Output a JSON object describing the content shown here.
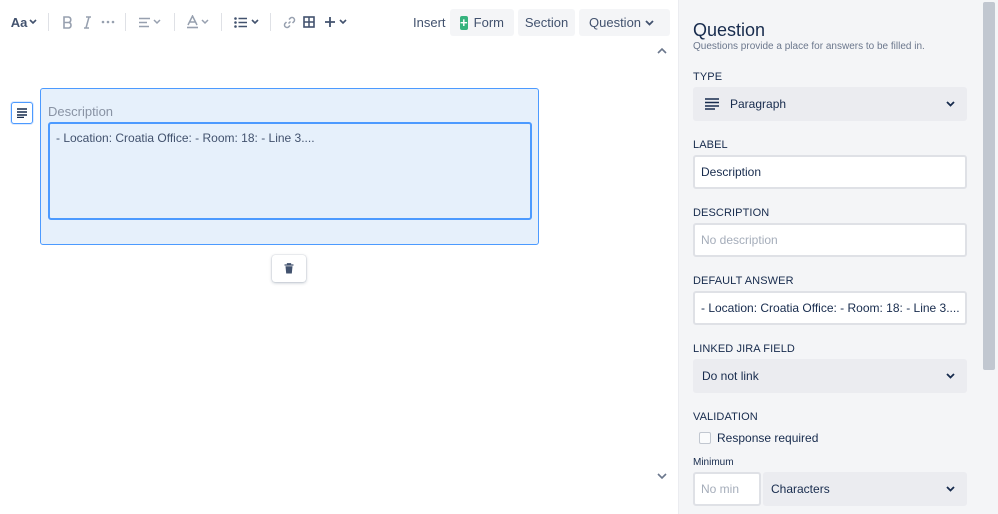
{
  "toolbar": {
    "text_style_label": "Aa",
    "insert_label": "Insert",
    "form_label": "Form",
    "section_label": "Section",
    "question_label": "Question"
  },
  "editor": {
    "question": {
      "label": "Description",
      "default_text": "- Location: Croatia Office: - Room: 18: - Line 3...."
    }
  },
  "panel": {
    "title": "Question",
    "subtitle": "Questions provide a place for answers to be filled in.",
    "type_label": "TYPE",
    "type_value": "Paragraph",
    "label_label": "LABEL",
    "label_value": "Description",
    "description_label": "DESCRIPTION",
    "description_placeholder": "No description",
    "default_answer_label": "DEFAULT ANSWER",
    "default_answer_value": "- Location: Croatia Office: - Room: 18: - Line 3....",
    "linked_field_label": "LINKED JIRA FIELD",
    "linked_field_value": "Do not link",
    "validation_label": "VALIDATION",
    "response_required_label": "Response required",
    "minimum_label": "Minimum",
    "minimum_placeholder": "No min",
    "unit_value": "Characters"
  },
  "colors": {
    "accent": "#4c9aff",
    "selected_bg": "#e6f0fb",
    "form_icon": "#36b37e",
    "panel_bg": "#f4f5f7"
  }
}
